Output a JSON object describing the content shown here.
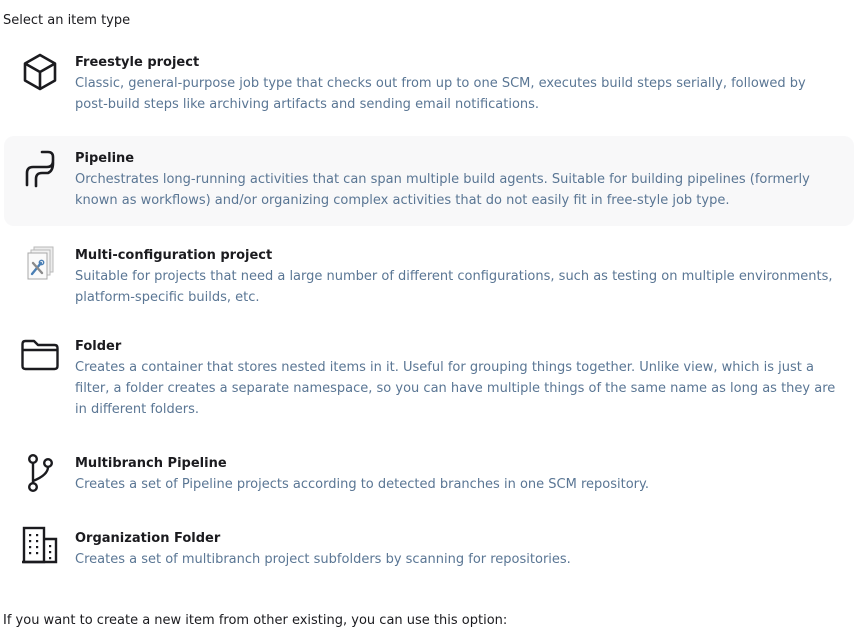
{
  "section_title": "Select an item type",
  "items": [
    {
      "label": "Freestyle project",
      "description": "Classic, general-purpose job type that checks out from up to one SCM, executes build steps serially, followed by post-build steps like archiving artifacts and sending email notifications.",
      "icon": "cube-icon",
      "selected": false
    },
    {
      "label": "Pipeline",
      "description": "Orchestrates long-running activities that can span multiple build agents. Suitable for building pipelines (formerly known as workflows) and/or organizing complex activities that do not easily fit in free-style job type.",
      "icon": "pipeline-icon",
      "selected": true
    },
    {
      "label": "Multi-configuration project",
      "description": "Suitable for projects that need a large number of different configurations, such as testing on multiple environments, platform-specific builds, etc.",
      "icon": "multi-config-icon",
      "selected": false
    },
    {
      "label": "Folder",
      "description": "Creates a container that stores nested items in it. Useful for grouping things together. Unlike view, which is just a filter, a folder creates a separate namespace, so you can have multiple things of the same name as long as they are in different folders.",
      "icon": "folder-icon",
      "selected": false
    },
    {
      "label": "Multibranch Pipeline",
      "description": "Creates a set of Pipeline projects according to detected branches in one SCM repository.",
      "icon": "git-branch-icon",
      "selected": false
    },
    {
      "label": "Organization Folder",
      "description": "Creates a set of multibranch project subfolders by scanning for repositories.",
      "icon": "building-icon",
      "selected": false
    }
  ],
  "footer_text": "If you want to create a new item from other existing, you can use this option:",
  "colors": {
    "label": "#1b1b1f",
    "description": "#5a7694",
    "selected_background": "#f8f8f9"
  }
}
